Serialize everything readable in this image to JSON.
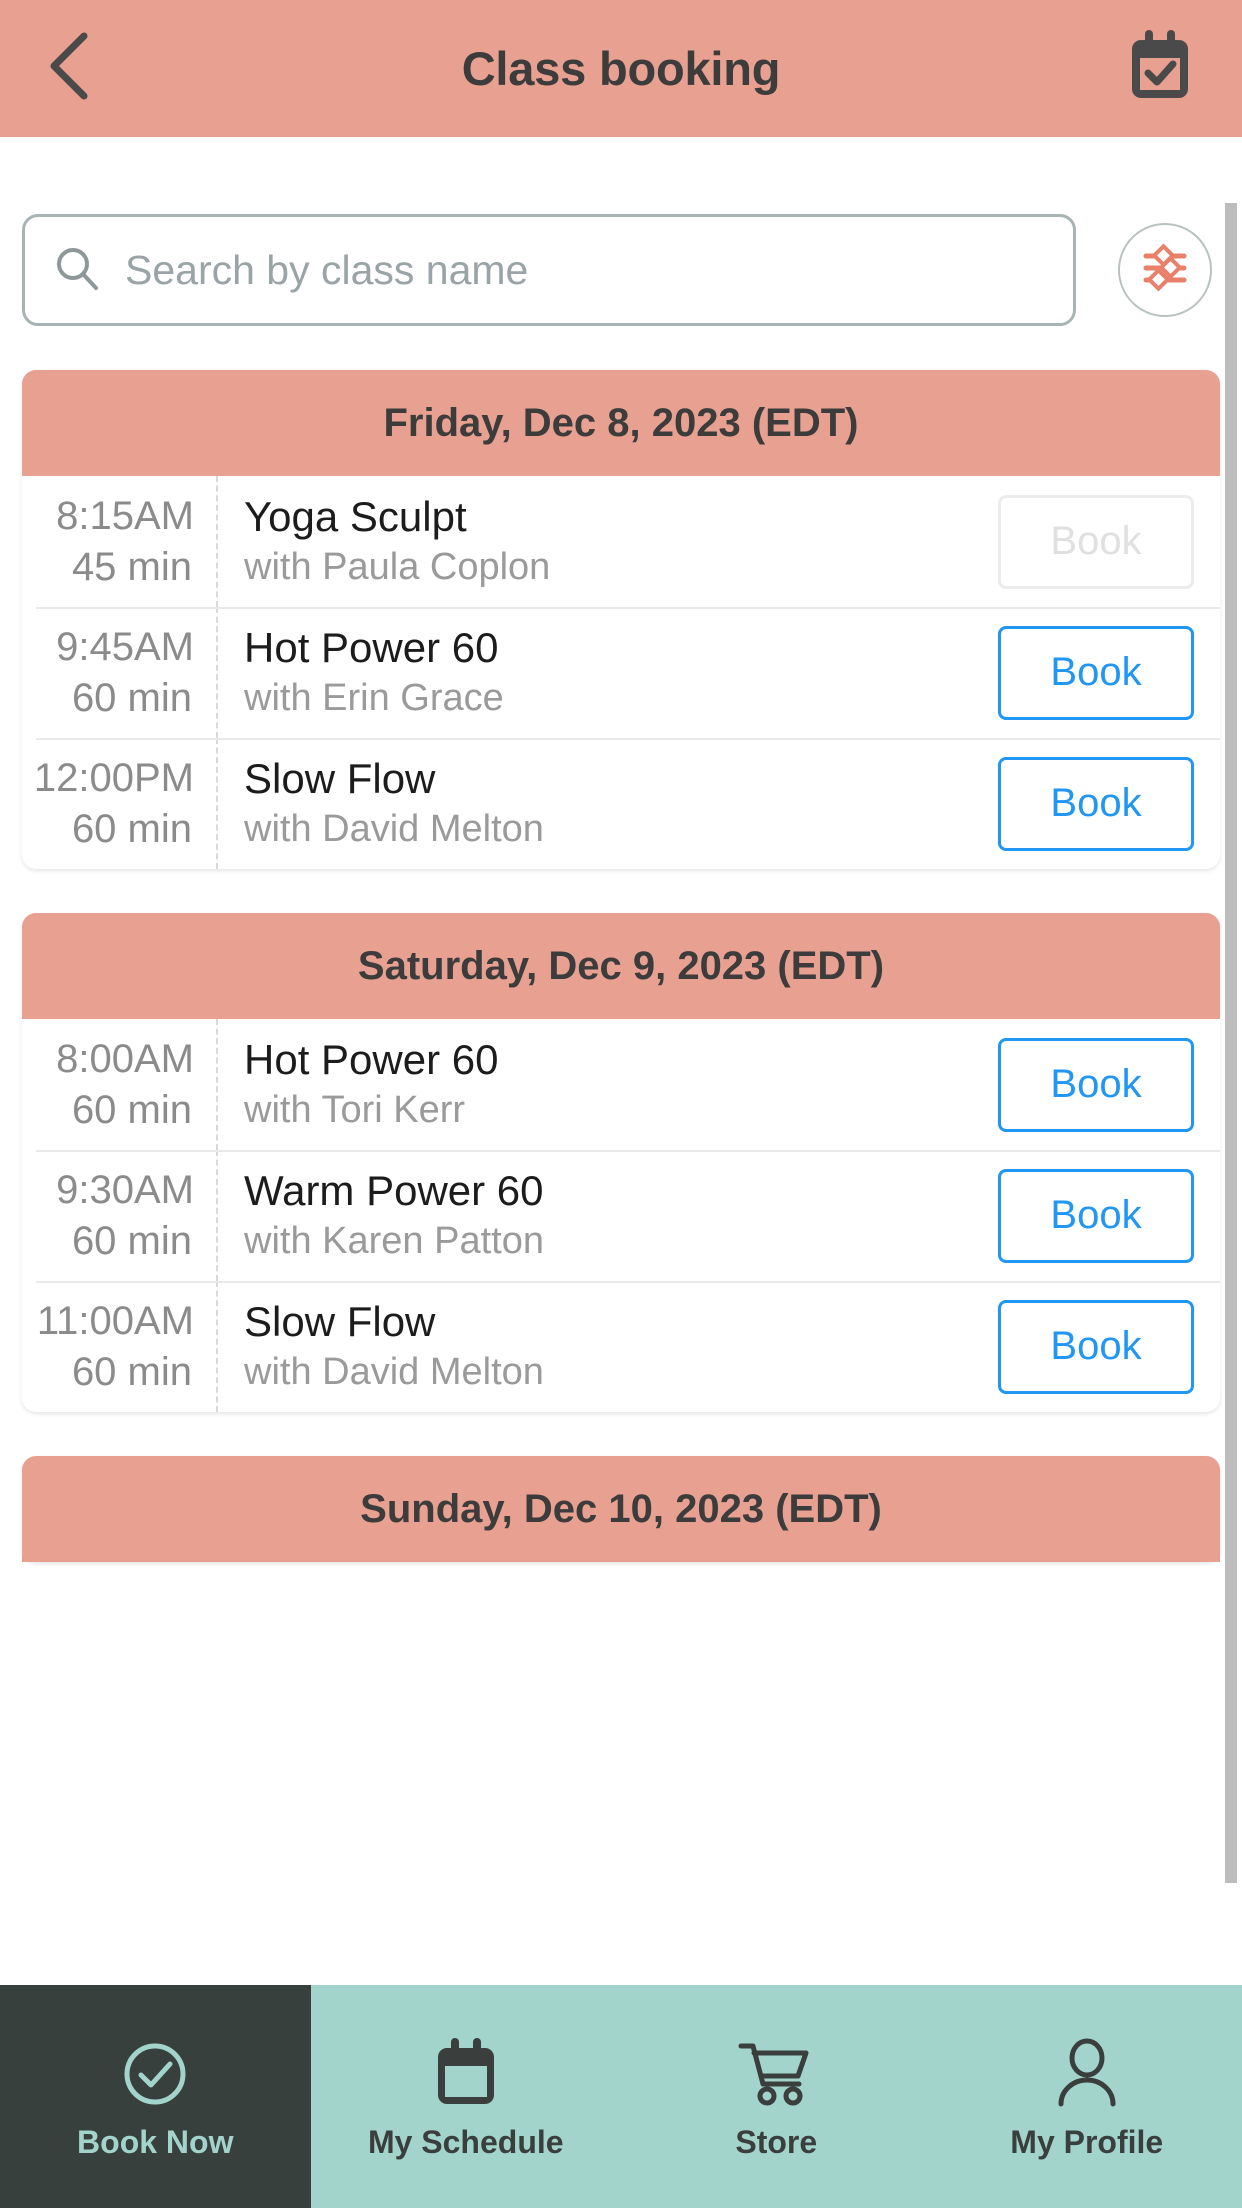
{
  "header": {
    "title": "Class booking",
    "back_icon": "chevron-left-icon",
    "calendar_icon": "calendar-check-icon"
  },
  "search": {
    "placeholder": "Search by class name",
    "value": "",
    "search_icon": "search-icon",
    "filter_icon": "filter-sliders-icon"
  },
  "colors": {
    "header_bg": "#e8a091",
    "day_header_bg": "#e8a091",
    "book_blue": "#2196f3",
    "nav_bg": "#a3d4cb",
    "nav_active_bg": "#38403e",
    "filter_icon": "#e8806a"
  },
  "days": [
    {
      "label": "Friday, Dec 8, 2023 (EDT)",
      "classes": [
        {
          "time": "8:15",
          "meridiem": "AM",
          "duration": "45 min",
          "name": "Yoga Sculpt",
          "instructor": "with Paula Coplon",
          "button_label": "Book",
          "disabled": true
        },
        {
          "time": "9:45",
          "meridiem": "AM",
          "duration": "60 min",
          "name": "Hot Power 60",
          "instructor": "with Erin Grace",
          "button_label": "Book",
          "disabled": false
        },
        {
          "time": "12:00",
          "meridiem": "PM",
          "duration": "60 min",
          "name": "Slow Flow",
          "instructor": "with David Melton",
          "button_label": "Book",
          "disabled": false
        }
      ]
    },
    {
      "label": "Saturday, Dec 9, 2023 (EDT)",
      "classes": [
        {
          "time": "8:00",
          "meridiem": "AM",
          "duration": "60 min",
          "name": "Hot Power 60",
          "instructor": "with Tori Kerr",
          "button_label": "Book",
          "disabled": false
        },
        {
          "time": "9:30",
          "meridiem": "AM",
          "duration": "60 min",
          "name": "Warm Power 60",
          "instructor": "with Karen Patton",
          "button_label": "Book",
          "disabled": false
        },
        {
          "time": "11:00",
          "meridiem": "AM",
          "duration": "60 min",
          "name": "Slow Flow",
          "instructor": "with David Melton",
          "button_label": "Book",
          "disabled": false
        }
      ]
    },
    {
      "label": "Sunday, Dec 10, 2023 (EDT)",
      "classes": []
    }
  ],
  "bottom_nav": [
    {
      "label": "Book Now",
      "icon": "check-circle-icon",
      "active": true
    },
    {
      "label": "My Schedule",
      "icon": "calendar-icon",
      "active": false
    },
    {
      "label": "Store",
      "icon": "shopping-cart-icon",
      "active": false
    },
    {
      "label": "My Profile",
      "icon": "person-icon",
      "active": false
    }
  ]
}
